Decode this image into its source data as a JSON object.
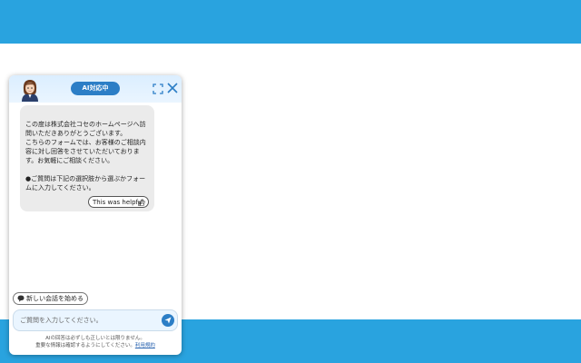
{
  "chat": {
    "badge": "AI対応中",
    "message": "この度は株式会社コセのホームページへ訪\n問いただきありがとうございます。\nこちらのフォームでは、お客様のご相談内\n容に対し回答をさせていただいておりま\nす。お気軽にご相談ください。\n\n●ご質問は下記の選択肢から選ぶかフォー\nムに入力してください。",
    "helpful_label": "This was helpful",
    "new_chat_label": "新しい会話を始める",
    "input_placeholder": "ご質問を入力してください。",
    "disclaimer_line1": "AIの回答は必ずしも正しいとは限りません。",
    "disclaimer_line2": "重要な情報は確認するようにしてください。",
    "terms_link": "利用規約"
  },
  "colors": {
    "brand_band": "#29a3df",
    "badge_bg": "#2c7ec6",
    "bubble_bg": "#ebebeb",
    "input_bg": "#eaf5ff"
  }
}
